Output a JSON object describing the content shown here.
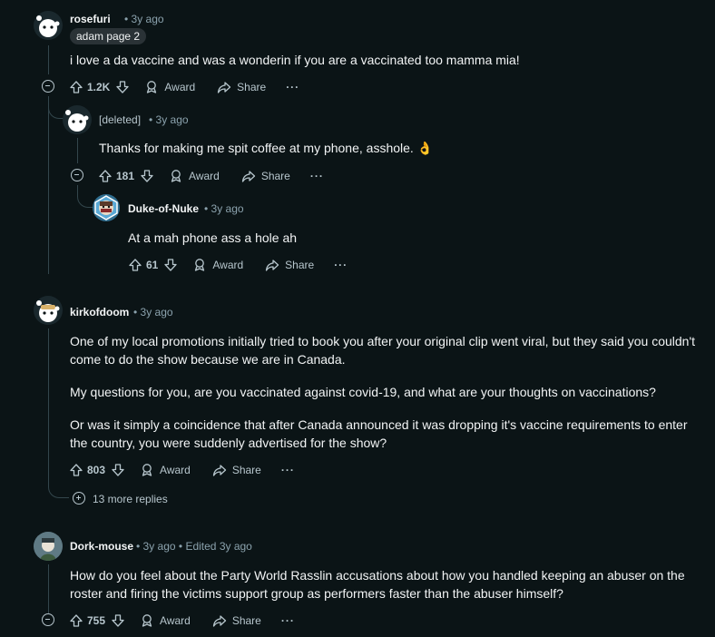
{
  "colors": {
    "background": "#0b1416",
    "text": "#f2f4f5",
    "meta": "#8ba2ad",
    "rail": "#33464c"
  },
  "comments": [
    {
      "username": "rosefuri",
      "time": "3y ago",
      "flair": "adam page 2",
      "body": "i love a da vaccine and was a wonderin if you are a vaccinated too mamma mia!",
      "score": "1.2K",
      "award": "Award",
      "share": "Share",
      "more": "···"
    },
    {
      "username": "[deleted]",
      "time": "3y ago",
      "body": "Thanks for making me spit coffee at my phone, asshole. 👌",
      "score": "181",
      "award": "Award",
      "share": "Share",
      "more": "···"
    },
    {
      "username": "Duke-of-Nuke",
      "time": "3y ago",
      "body": "At a mah phone ass a hole ah",
      "score": "61",
      "award": "Award",
      "share": "Share",
      "more": "···"
    },
    {
      "username": "kirkofdoom",
      "time": "3y ago",
      "body_p1": "One of my local promotions initially tried to book you after your original clip went viral, but they said you couldn't come to do the show because we are in Canada.",
      "body_p2": "My questions for you, are you vaccinated against covid-19, and what are your thoughts on vaccinations?",
      "body_p3": "Or was it simply a coincidence that after Canada announced it was dropping it's vaccine requirements to enter the country, you were suddenly advertised for the show?",
      "score": "803",
      "award": "Award",
      "share": "Share",
      "more": "···",
      "more_replies": "13 more replies"
    },
    {
      "username": "Dork-mouse",
      "time": "3y ago",
      "edited": "Edited 3y ago",
      "body": "How do you feel about the Party World Rasslin accusations about how you handled keeping an abuser on the roster and firing the victims support group as performers faster than the abuser himself?",
      "score": "755",
      "award": "Award",
      "share": "Share",
      "more": "···"
    }
  ]
}
